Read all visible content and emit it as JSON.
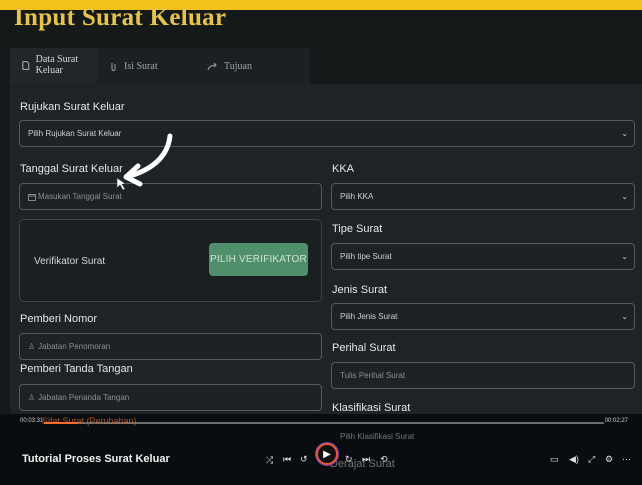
{
  "header": {
    "title": "Input Surat Keluar"
  },
  "tabs": [
    {
      "icon": "file-icon",
      "label": "Data Surat Keluar"
    },
    {
      "icon": "paperclip-icon",
      "label": "Isi Surat"
    },
    {
      "icon": "share-arrow-icon",
      "label": "Tujuan"
    }
  ],
  "form": {
    "rujukan_label": "Rujukan Surat Keluar",
    "rujukan_value": "Pilih Rujukan Surat Keluar",
    "tanggal_label": "Tanggal Surat Keluar",
    "tanggal_placeholder": "Masukan Tanggal Surat",
    "verifikator_label": "Verifikator Surat",
    "verifikator_button": "PILIH VERIFIKATOR",
    "pemberi_nomor_label": "Pemberi Nomor",
    "pemberi_nomor_placeholder": "Jabatan Penomoran",
    "pemberi_ttd_label": "Pemberi Tanda Tangan",
    "pemberi_ttd_placeholder": "Jabatan Penanda Tangan",
    "kka_label": "KKA",
    "kka_value": "Pilih KKA",
    "tipe_label": "Tipe Surat",
    "tipe_value": "Pilih tipe Surat",
    "jenis_label": "Jenis Surat",
    "jenis_value": "Pilih Jenis Surat",
    "perihal_label": "Perihal Surat",
    "perihal_placeholder": "Tulis Perihal Surat",
    "klasifikasi_label": "Klasifikasi Surat",
    "klasifikasi_value": "Pilih Klasifikasi Surat",
    "derajat_label": "Derajat Surat",
    "ghost_text": "Sifat Surat (Perubahan)"
  },
  "player": {
    "title": "Tutorial Proses Surat Keluar",
    "time_current": "00:03:31",
    "time_total": "00:02:27",
    "progress": 0.06
  },
  "colors": {
    "accent": "#e6c34d",
    "topbar": "#f2c21b",
    "button": "#4f8f6c",
    "progress": "#ff6a2a"
  }
}
